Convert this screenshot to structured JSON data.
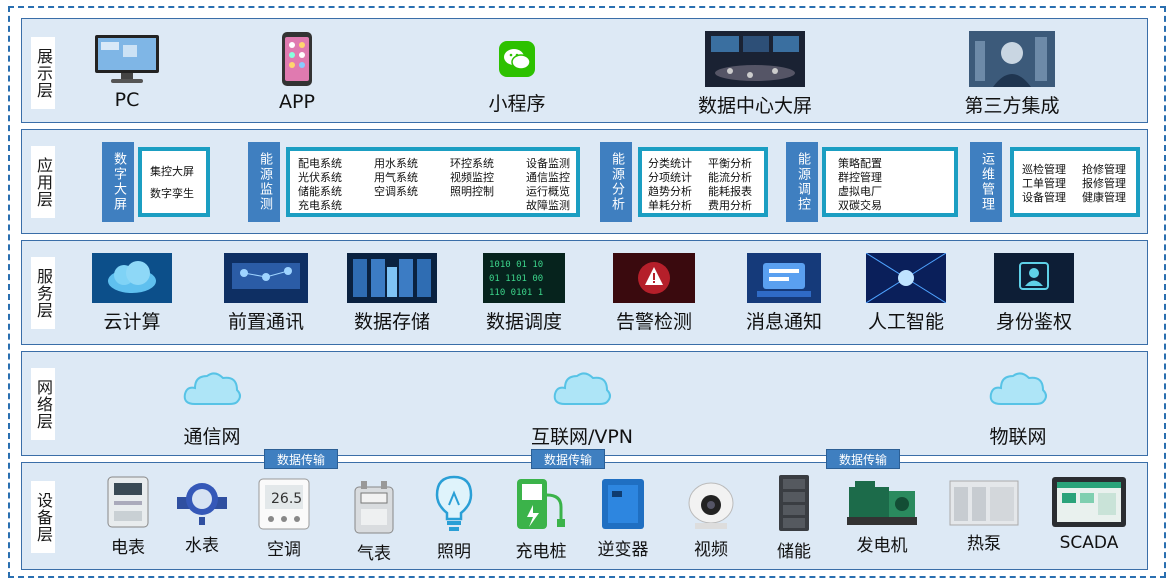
{
  "layers": {
    "display": {
      "label": "展示层",
      "items": [
        {
          "name": "PC",
          "icon": "monitor-icon"
        },
        {
          "name": "APP",
          "icon": "phone-icon"
        },
        {
          "name": "小程序",
          "icon": "wechat-icon"
        },
        {
          "name": "数据中心大屏",
          "icon": "big-screen-icon"
        },
        {
          "name": "第三方集成",
          "icon": "integration-icon"
        }
      ]
    },
    "application": {
      "label": "应用层",
      "modules": [
        {
          "tag": "数字大屏",
          "items": [
            "集控大屏",
            "数字孪生"
          ]
        },
        {
          "tag": "能源监测",
          "items": [
            "配电系统",
            "用水系统",
            "环控系统",
            "设备监测",
            "光伏系统",
            "用气系统",
            "视频监控",
            "通信监控",
            "储能系统",
            "空调系统",
            "照明控制",
            "运行概览",
            "充电系统",
            "",
            "",
            "故障监测"
          ]
        },
        {
          "tag": "能源分析",
          "items": [
            "分类统计",
            "平衡分析",
            "分项统计",
            "能流分析",
            "趋势分析",
            "能耗报表",
            "单耗分析",
            "费用分析"
          ]
        },
        {
          "tag": "能源调控",
          "items": [
            "策略配置",
            "群控管理",
            "虚拟电厂",
            "双碳交易"
          ]
        },
        {
          "tag": "运维管理",
          "items": [
            "巡检管理",
            "抢修管理",
            "工单管理",
            "报修管理",
            "设备管理",
            "健康管理"
          ]
        }
      ]
    },
    "service": {
      "label": "服务层",
      "items": [
        "云计算",
        "前置通讯",
        "数据存储",
        "数据调度",
        "告警检测",
        "消息通知",
        "人工智能",
        "身份鉴权"
      ]
    },
    "network": {
      "label": "网络层",
      "items": [
        "通信网",
        "互联网/VPN",
        "物联网"
      ]
    },
    "device": {
      "label": "设备层",
      "items": [
        "电表",
        "水表",
        "空调",
        "气表",
        "照明",
        "充电桩",
        "逆变器",
        "视频",
        "储能",
        "发电机",
        "热泵",
        "SCADA"
      ]
    }
  },
  "transfer_label": "数据传输",
  "colors": {
    "layer_bg": "#dde9f5",
    "border": "#3a6ea8",
    "tag": "#3f7fc0",
    "panel": "#1b9ec2",
    "cloud": "#7fd3ef"
  }
}
